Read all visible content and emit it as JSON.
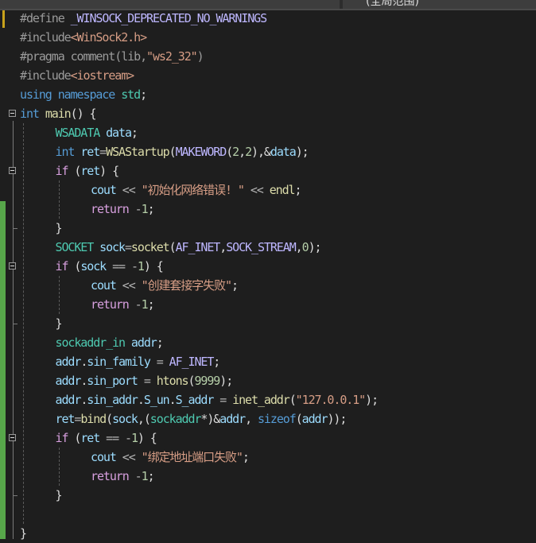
{
  "header": {
    "scope_label": "(全局范围)"
  },
  "colors": {
    "background": "#1e1e1e",
    "changed_marker": "#57a64a",
    "unsaved_marker": "#c8a21b"
  },
  "editor": {
    "lines": [
      {
        "indent": 0,
        "tokens": [
          [
            "#define ",
            "pp"
          ],
          [
            "_WINSOCK_DEPRECATED_NO_WARNINGS",
            "mac"
          ]
        ]
      },
      {
        "indent": 0,
        "tokens": [
          [
            "#include",
            "pp"
          ],
          [
            "<WinSock2.h>",
            "str"
          ]
        ]
      },
      {
        "indent": 0,
        "tokens": [
          [
            "#pragma comment(lib,",
            "pp"
          ],
          [
            "\"ws2_32\"",
            "str"
          ],
          [
            ")",
            "pp"
          ]
        ]
      },
      {
        "indent": 0,
        "tokens": [
          [
            "#include",
            "pp"
          ],
          [
            "<iostream>",
            "str"
          ]
        ]
      },
      {
        "indent": 0,
        "tokens": [
          [
            "using namespace ",
            "kw"
          ],
          [
            "std",
            "ty"
          ],
          [
            ";",
            "pl"
          ]
        ]
      },
      {
        "indent": 0,
        "tokens": [
          [
            "int ",
            "kw"
          ],
          [
            "main",
            "fn"
          ],
          [
            "() {",
            "pl"
          ]
        ]
      },
      {
        "indent": 1,
        "tokens": [
          [
            "WSADATA ",
            "ty"
          ],
          [
            "data",
            "var"
          ],
          [
            ";",
            "pl"
          ]
        ]
      },
      {
        "indent": 1,
        "tokens": [
          [
            "int ",
            "kw"
          ],
          [
            "ret",
            "var"
          ],
          [
            "=",
            "op"
          ],
          [
            "WSAStartup",
            "fn"
          ],
          [
            "(",
            "pl"
          ],
          [
            "MAKEWORD",
            "mac"
          ],
          [
            "(",
            "pl"
          ],
          [
            "2",
            "num"
          ],
          [
            ",",
            "pl"
          ],
          [
            "2",
            "num"
          ],
          [
            "),&",
            "pl"
          ],
          [
            "data",
            "var"
          ],
          [
            ");",
            "pl"
          ]
        ]
      },
      {
        "indent": 1,
        "tokens": [
          [
            "if ",
            "ctl"
          ],
          [
            "(",
            "pl"
          ],
          [
            "ret",
            "var"
          ],
          [
            ") {",
            "pl"
          ]
        ]
      },
      {
        "indent": 2,
        "tokens": [
          [
            "cout ",
            "var"
          ],
          [
            "<< ",
            "op"
          ],
          [
            "\"初始化网络错误! \"",
            "str"
          ],
          [
            " << ",
            "op"
          ],
          [
            "endl",
            "fn"
          ],
          [
            ";",
            "pl"
          ]
        ]
      },
      {
        "indent": 2,
        "tokens": [
          [
            "return ",
            "ctl"
          ],
          [
            "-",
            "op"
          ],
          [
            "1",
            "num"
          ],
          [
            ";",
            "pl"
          ]
        ]
      },
      {
        "indent": 1,
        "tokens": [
          [
            "}",
            "pl"
          ]
        ]
      },
      {
        "indent": 1,
        "tokens": [
          [
            "SOCKET ",
            "ty"
          ],
          [
            "sock",
            "var"
          ],
          [
            "=",
            "op"
          ],
          [
            "socket",
            "fn"
          ],
          [
            "(",
            "pl"
          ],
          [
            "AF_INET",
            "mac"
          ],
          [
            ",",
            "pl"
          ],
          [
            "SOCK_STREAM",
            "mac"
          ],
          [
            ",",
            "pl"
          ],
          [
            "0",
            "num"
          ],
          [
            ");",
            "pl"
          ]
        ]
      },
      {
        "indent": 1,
        "tokens": [
          [
            "if ",
            "ctl"
          ],
          [
            "(",
            "pl"
          ],
          [
            "sock ",
            "var"
          ],
          [
            "== ",
            "op"
          ],
          [
            "-",
            "op"
          ],
          [
            "1",
            "num"
          ],
          [
            ") {",
            "pl"
          ]
        ]
      },
      {
        "indent": 2,
        "tokens": [
          [
            "cout ",
            "var"
          ],
          [
            "<< ",
            "op"
          ],
          [
            "\"创建套接字失败\"",
            "str"
          ],
          [
            ";",
            "pl"
          ]
        ]
      },
      {
        "indent": 2,
        "tokens": [
          [
            "return ",
            "ctl"
          ],
          [
            "-",
            "op"
          ],
          [
            "1",
            "num"
          ],
          [
            ";",
            "pl"
          ]
        ]
      },
      {
        "indent": 1,
        "tokens": [
          [
            "}",
            "pl"
          ]
        ]
      },
      {
        "indent": 1,
        "tokens": [
          [
            "sockaddr_in ",
            "ty"
          ],
          [
            "addr",
            "var"
          ],
          [
            ";",
            "pl"
          ]
        ]
      },
      {
        "indent": 1,
        "tokens": [
          [
            "addr",
            "var"
          ],
          [
            ".",
            "pl"
          ],
          [
            "sin_family ",
            "var"
          ],
          [
            "= ",
            "op"
          ],
          [
            "AF_INET",
            "mac"
          ],
          [
            ";",
            "pl"
          ]
        ]
      },
      {
        "indent": 1,
        "tokens": [
          [
            "addr",
            "var"
          ],
          [
            ".",
            "pl"
          ],
          [
            "sin_port ",
            "var"
          ],
          [
            "= ",
            "op"
          ],
          [
            "htons",
            "fn"
          ],
          [
            "(",
            "pl"
          ],
          [
            "9999",
            "num"
          ],
          [
            ");",
            "pl"
          ]
        ]
      },
      {
        "indent": 1,
        "tokens": [
          [
            "addr",
            "var"
          ],
          [
            ".",
            "pl"
          ],
          [
            "sin_addr",
            "var"
          ],
          [
            ".",
            "pl"
          ],
          [
            "S_un",
            "var"
          ],
          [
            ".",
            "pl"
          ],
          [
            "S_addr ",
            "var"
          ],
          [
            "= ",
            "op"
          ],
          [
            "inet_addr",
            "fn"
          ],
          [
            "(",
            "pl"
          ],
          [
            "\"127.0.0.1\"",
            "str"
          ],
          [
            ");",
            "pl"
          ]
        ]
      },
      {
        "indent": 1,
        "tokens": [
          [
            "ret",
            "var"
          ],
          [
            "=",
            "op"
          ],
          [
            "bind",
            "fn"
          ],
          [
            "(",
            "pl"
          ],
          [
            "sock",
            "var"
          ],
          [
            ",(",
            "pl"
          ],
          [
            "sockaddr",
            "ty"
          ],
          [
            "*)&",
            "pl"
          ],
          [
            "addr",
            "var"
          ],
          [
            ", ",
            "pl"
          ],
          [
            "sizeof",
            "kw"
          ],
          [
            "(",
            "pl"
          ],
          [
            "addr",
            "var"
          ],
          [
            "));",
            "pl"
          ]
        ]
      },
      {
        "indent": 1,
        "tokens": [
          [
            "if ",
            "ctl"
          ],
          [
            "(",
            "pl"
          ],
          [
            "ret ",
            "var"
          ],
          [
            "== ",
            "op"
          ],
          [
            "-",
            "op"
          ],
          [
            "1",
            "num"
          ],
          [
            ") {",
            "pl"
          ]
        ]
      },
      {
        "indent": 2,
        "tokens": [
          [
            "cout ",
            "var"
          ],
          [
            "<< ",
            "op"
          ],
          [
            "\"绑定地址端口失败\"",
            "str"
          ],
          [
            ";",
            "pl"
          ]
        ]
      },
      {
        "indent": 2,
        "tokens": [
          [
            "return ",
            "ctl"
          ],
          [
            "-",
            "op"
          ],
          [
            "1",
            "num"
          ],
          [
            ";",
            "pl"
          ]
        ]
      },
      {
        "indent": 1,
        "tokens": [
          [
            "}",
            "pl"
          ]
        ]
      },
      {
        "indent": 0,
        "tokens": []
      },
      {
        "indent": 0,
        "tokens": [
          [
            "}",
            "pl"
          ]
        ]
      }
    ]
  }
}
